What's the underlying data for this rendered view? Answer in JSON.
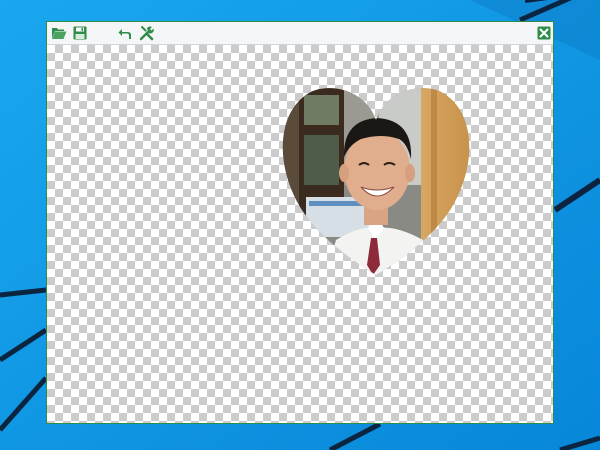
{
  "window": {
    "toolbar": {
      "open_icon": "folder-open-icon",
      "save_icon": "floppy-disk-icon",
      "undo_icon": "undo-arrow-icon",
      "tools_icon": "tools-icon",
      "close_icon": "close-icon"
    },
    "canvas": {
      "background": "transparency-checkerboard",
      "image": "heart-cropped-portrait"
    }
  },
  "colors": {
    "desktop": "#0a9be8",
    "accent": "#2f8d4a",
    "toolbar_bg": "#f4f5f6"
  }
}
